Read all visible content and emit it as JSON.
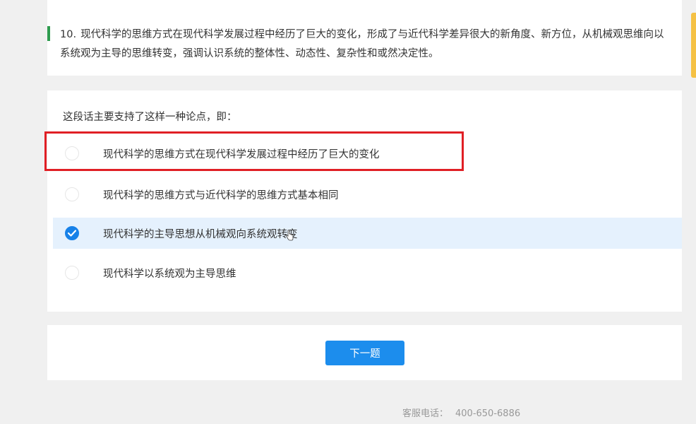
{
  "question": {
    "number": "10.",
    "text": "现代科学的思维方式在现代科学发展过程中经历了巨大的变化，形成了与近代科学差异很大的新角度、新方位，从机械观思维向以系统观为主导的思维转变，强调认识系统的整体性、动态性、复杂性和或然决定性。"
  },
  "prompt": "这段话主要支持了这样一种论点，即：",
  "options": [
    {
      "label": "现代科学的思维方式在现代科学发展过程中经历了巨大的变化",
      "selected": false
    },
    {
      "label": "现代科学的思维方式与近代科学的思维方式基本相同",
      "selected": false
    },
    {
      "label": "现代科学的主导思想从机械观向系统观转变",
      "selected": true
    },
    {
      "label": "现代科学以系统观为主导思维",
      "selected": false
    }
  ],
  "next_button": "下一题",
  "footer": {
    "label": "客服电话：",
    "phone": "400-650-6886"
  },
  "colors": {
    "accent_green": "#2e9b4e",
    "primary_blue": "#1c8ded",
    "selected_bg": "#e5f1fd",
    "highlight_red": "#e01f25"
  }
}
